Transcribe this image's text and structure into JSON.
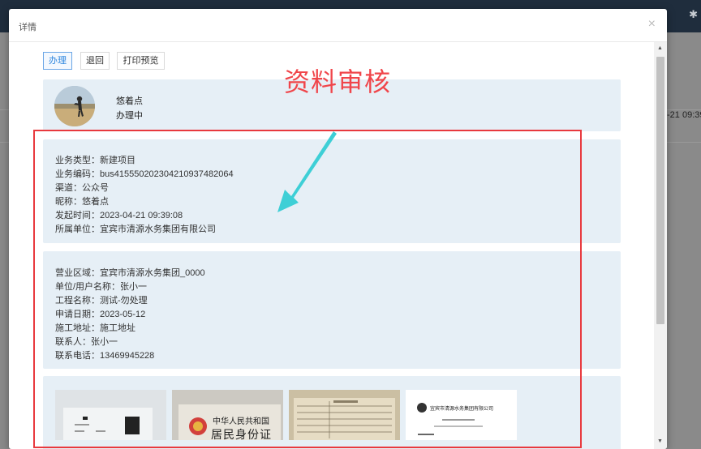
{
  "background": {
    "right_cell_text": "-21 09:39:"
  },
  "dialog": {
    "title": "详情",
    "close_glyph": "×"
  },
  "toolbar": {
    "handle_label": "办理",
    "return_label": "退回",
    "print_label": "打印预览"
  },
  "annotation": {
    "title": "资料审核"
  },
  "user": {
    "name": "悠着点",
    "status": "办理中"
  },
  "business": {
    "lines": [
      "业务类型：新建项目",
      "业务编码：bus41555020230421093748206​4",
      "渠道：公众号",
      "昵称：悠着点",
      "发起时间：2023-04-21 09:39:08",
      "所属单位：宜宾市清源水务集团有限公司"
    ]
  },
  "applicant": {
    "lines": [
      "营业区域：宜宾市清源水务集团_0000",
      "单位/用户名称：张小一",
      "工程名称：测试-勿处理",
      "申请日期：2023-05-12",
      "施工地址：施工地址",
      "联系人：张小一",
      "联系电话：13469945228"
    ]
  },
  "attachments": {
    "idcard_line1": "中华人民共和国",
    "idcard_line2": "居民身份证",
    "doc4_header": "宜宾市清源水务集团有限公司"
  },
  "colors": {
    "accent_red": "#e8393e",
    "annotation_arrow": "#3ecfd6",
    "card_bg": "#e6eff6"
  }
}
